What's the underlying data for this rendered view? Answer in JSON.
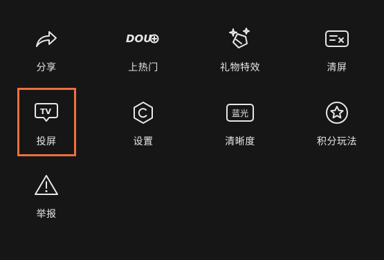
{
  "menu": {
    "items": [
      {
        "id": "share",
        "label": "分享",
        "icon": "share-arrow-icon"
      },
      {
        "id": "trending",
        "label": "上热门",
        "icon": "dou-plus-icon",
        "icon_text": "DOU"
      },
      {
        "id": "gift",
        "label": "礼物特效",
        "icon": "gift-sparkle-icon"
      },
      {
        "id": "clear",
        "label": "清屏",
        "icon": "clear-screen-icon"
      },
      {
        "id": "cast",
        "label": "投屏",
        "icon": "tv-cast-icon",
        "icon_text": "TV"
      },
      {
        "id": "settings",
        "label": "设置",
        "icon": "settings-hexagon-icon"
      },
      {
        "id": "quality",
        "label": "清晰度",
        "icon": "quality-badge-icon",
        "icon_text": "蓝光"
      },
      {
        "id": "points",
        "label": "积分玩法",
        "icon": "star-circle-icon"
      },
      {
        "id": "report",
        "label": "举报",
        "icon": "warning-triangle-icon"
      }
    ]
  },
  "highlight": {
    "target": "cast",
    "color": "#f07040"
  },
  "colors": {
    "background": "#161616",
    "foreground": "#e8e8e8"
  }
}
